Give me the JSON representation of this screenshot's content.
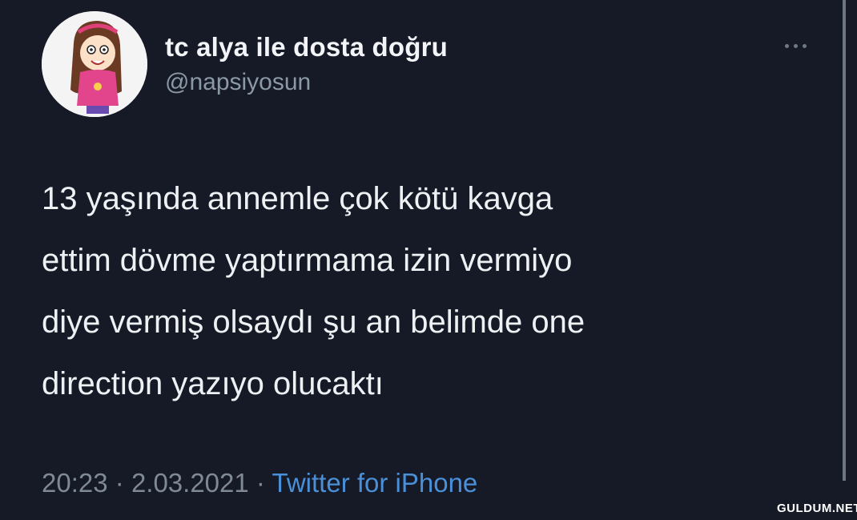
{
  "tweet": {
    "display_name": "tc alya ile dosta doğru",
    "handle": "@napsiyosun",
    "text": "13 yaşında annemle çok kötü kavga\nettim dövme yaptırmama izin vermiyo\ndiye vermiş olsaydı şu an belimde one\ndirection yazıyo olucaktı",
    "time": "20:23",
    "separator_1": "·",
    "date": "2.03.2021",
    "separator_2": "·",
    "source": "Twitter for iPhone"
  },
  "icons": {
    "avatar": "cartoon-girl-avatar",
    "more": "more-options-icon"
  },
  "watermark": "GULDUM.NET",
  "colors": {
    "background": "#161a26",
    "name": "#f2f4f7",
    "handle": "#8b98a5",
    "text": "#eef1f4",
    "meta": "#7f8a96",
    "source_link": "#4a90d9"
  }
}
